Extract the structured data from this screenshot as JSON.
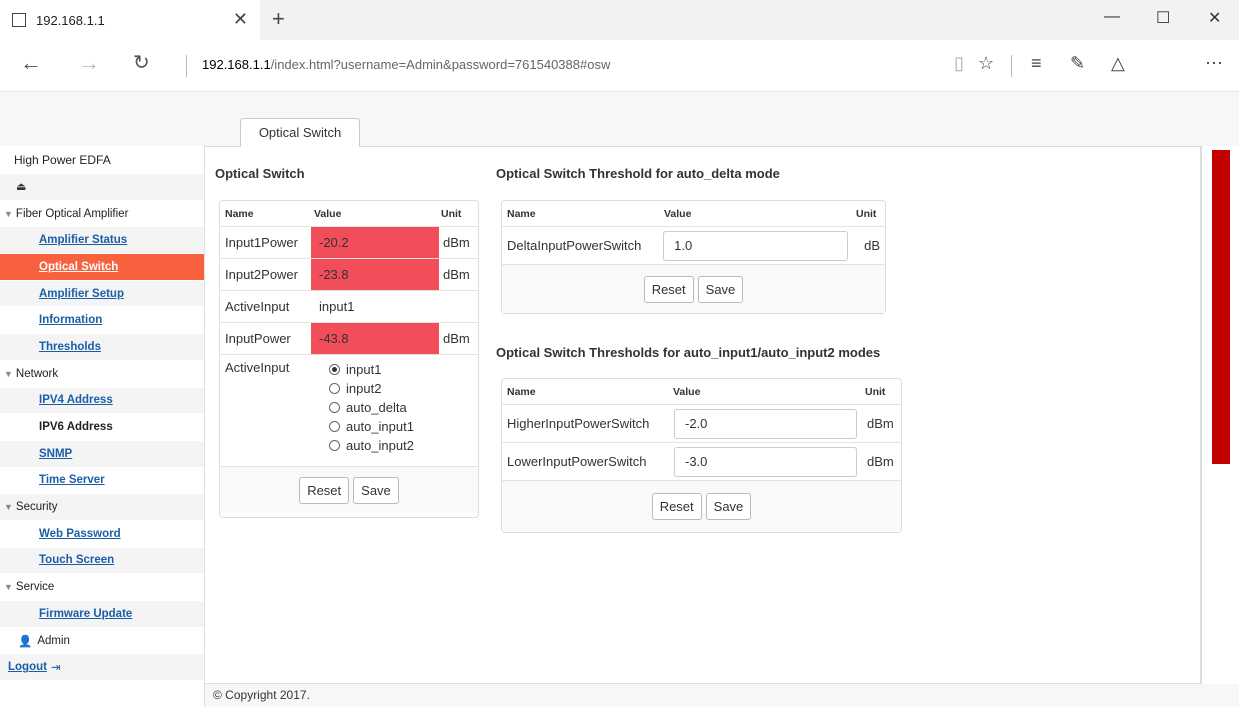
{
  "browser": {
    "tab_title": "192.168.1.1",
    "url_host": "192.168.1.1",
    "url_rest": "/index.html?username=Admin&password=761540388#osw"
  },
  "page_tab": "Optical Switch",
  "sidebar": {
    "title": "High Power EDFA",
    "groups": {
      "fiber": "Fiber Optical Amplifier",
      "network": "Network",
      "security": "Security",
      "service": "Service"
    },
    "items": {
      "amplifier_status": "Amplifier Status",
      "optical_switch": "Optical Switch",
      "amplifier_setup": "Amplifier Setup",
      "information": "Information",
      "thresholds": "Thresholds",
      "ipv4": "IPV4 Address",
      "ipv6": "IPV6 Address",
      "snmp": "SNMP",
      "time_server": "Time Server",
      "web_password": "Web Password",
      "touch_screen": "Touch Screen",
      "firmware_update": "Firmware Update"
    },
    "admin": "Admin",
    "logout": "Logout"
  },
  "optical_switch": {
    "title": "Optical Switch",
    "headers": {
      "name": "Name",
      "value": "Value",
      "unit": "Unit"
    },
    "input1power": {
      "name": "Input1Power",
      "value": "-20.2",
      "unit": "dBm"
    },
    "input2power": {
      "name": "Input2Power",
      "value": "-23.8",
      "unit": "dBm"
    },
    "activeinput_ro": {
      "name": "ActiveInput",
      "value": "input1"
    },
    "inputpower": {
      "name": "InputPower",
      "value": "-43.8",
      "unit": "dBm"
    },
    "activeinput_sel": {
      "name": "ActiveInput",
      "options": [
        "input1",
        "input2",
        "auto_delta",
        "auto_input1",
        "auto_input2"
      ]
    },
    "reset": "Reset",
    "save": "Save"
  },
  "delta_threshold": {
    "title": "Optical Switch Threshold for auto_delta mode",
    "headers": {
      "name": "Name",
      "value": "Value",
      "unit": "Unit"
    },
    "row": {
      "name": "DeltaInputPowerSwitch",
      "value": "1.0",
      "unit": "dB"
    },
    "reset": "Reset",
    "save": "Save"
  },
  "input_thresholds": {
    "title": "Optical Switch Thresholds for auto_input1/auto_input2 modes",
    "headers": {
      "name": "Name",
      "value": "Value",
      "unit": "Unit"
    },
    "higher": {
      "name": "HigherInputPowerSwitch",
      "value": "-2.0",
      "unit": "dBm"
    },
    "lower": {
      "name": "LowerInputPowerSwitch",
      "value": "-3.0",
      "unit": "dBm"
    },
    "reset": "Reset",
    "save": "Save"
  },
  "footer": "© Copyright 2017."
}
